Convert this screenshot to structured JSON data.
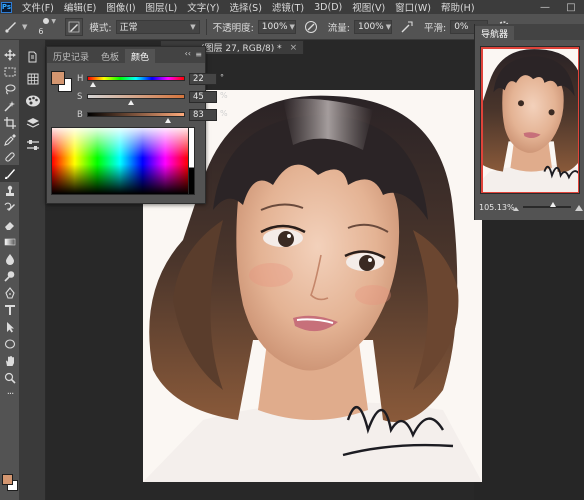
{
  "app": {
    "logo": "Ps"
  },
  "menubar": {
    "items": [
      "文件(F)",
      "编辑(E)",
      "图像(I)",
      "图层(L)",
      "文字(Y)",
      "选择(S)",
      "滤镜(T)",
      "3D(D)",
      "视图(V)",
      "窗口(W)",
      "帮助(H)"
    ],
    "window_controls": [
      "—",
      "□"
    ]
  },
  "options": {
    "brush_size": "6",
    "mode_label": "模式:",
    "mode_value": "正常",
    "opacity_label": "不透明度:",
    "opacity_value": "100%",
    "flow_label": "流量:",
    "flow_value": "100%",
    "smoothing_label": "平滑:",
    "smoothing_value": "0%"
  },
  "document": {
    "tab_title": "(图层 27, RGB/8) *",
    "close": "×"
  },
  "color_panel": {
    "tabs": [
      "历史记录",
      "色板",
      "颜色"
    ],
    "active_tab": 2,
    "collapse": "‹‹",
    "menu": "≡",
    "foreground_color": "#d49670",
    "background_color": "#ffffff",
    "h": {
      "label": "H",
      "value": "22",
      "unit": "°",
      "fraction": 0.06
    },
    "s": {
      "label": "S",
      "value": "45",
      "unit": "%",
      "fraction": 0.45
    },
    "b": {
      "label": "B",
      "value": "83",
      "unit": "%",
      "fraction": 0.83
    }
  },
  "navigator": {
    "title": "导航器",
    "zoom": "105.13%",
    "zoom_fraction": 0.62
  },
  "toolbar": {
    "active_tool": "brush-tool",
    "foreground_color": "#d49670",
    "background_color": "#ffffff"
  }
}
